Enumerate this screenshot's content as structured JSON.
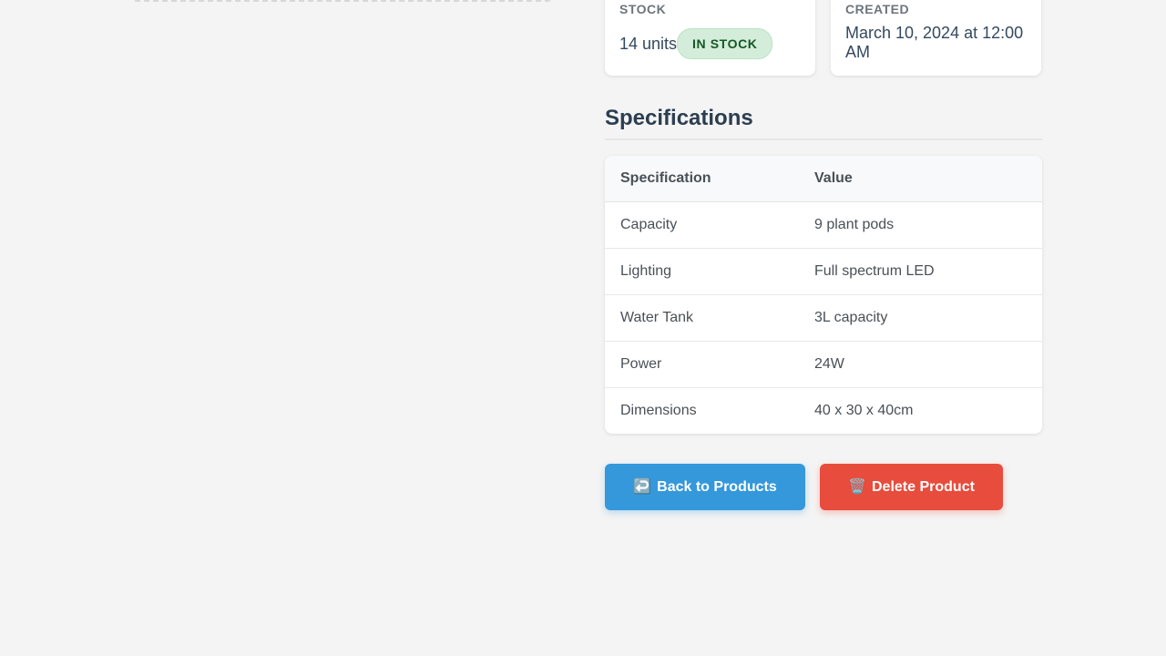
{
  "stock": {
    "label": "STOCK",
    "value": "14 units",
    "badge": "IN STOCK",
    "badge_color": "#d4edda"
  },
  "created": {
    "label": "CREATED",
    "value": "March 10, 2024 at 12:00 AM"
  },
  "specifications": {
    "title": "Specifications",
    "columns": [
      "Specification",
      "Value"
    ],
    "rows": [
      [
        "Capacity",
        "9 plant pods"
      ],
      [
        "Lighting",
        "Full spectrum LED"
      ],
      [
        "Water Tank",
        "3L capacity"
      ],
      [
        "Power",
        "24W"
      ],
      [
        "Dimensions",
        "40 x 30 x 40cm"
      ]
    ]
  },
  "actions": {
    "back_icon": "↩️",
    "back_label": "Back to Products",
    "back_color": "#3498db",
    "delete_icon": "🗑️",
    "delete_label": "Delete Product",
    "delete_color": "#e74c3c"
  }
}
